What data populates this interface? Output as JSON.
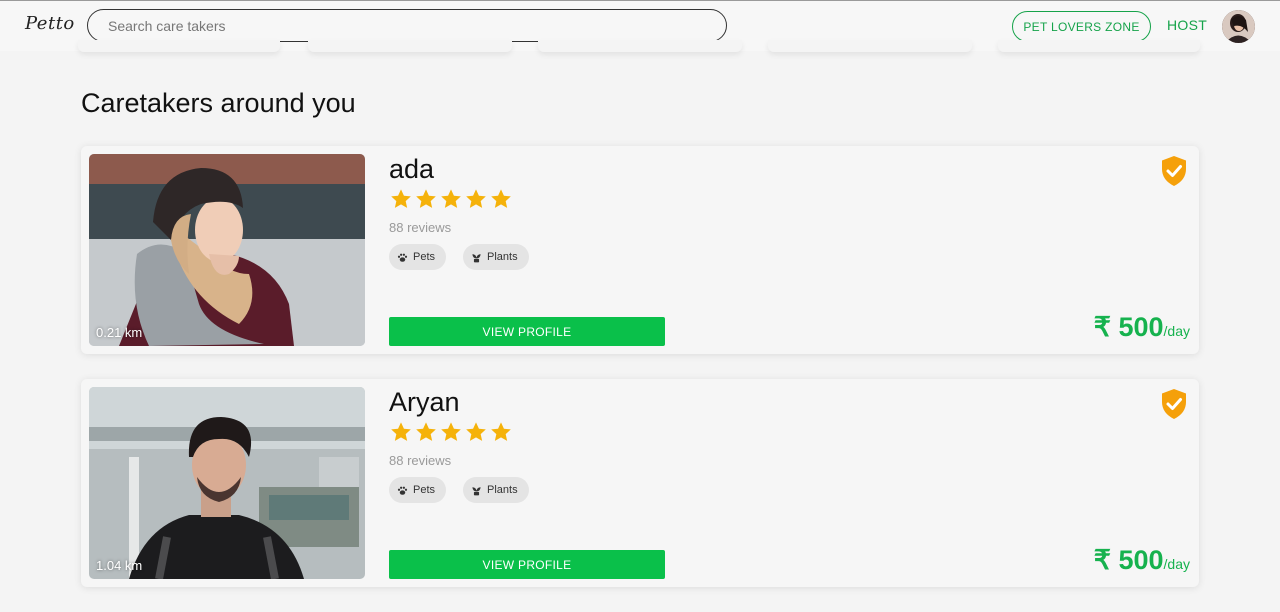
{
  "header": {
    "logo": "Petto",
    "search_placeholder": "Search care takers",
    "pet_lovers_label": "PET LOVERS ZONE",
    "host_label": "HOST"
  },
  "section_title": "Caretakers around you",
  "caretakers": [
    {
      "name": "ada",
      "rating": 5,
      "reviews": "88 reviews",
      "tags": [
        "Pets",
        "Plants"
      ],
      "distance": "0.21 km",
      "button": "VIEW PROFILE",
      "price": "₹ 500",
      "price_unit": "/day"
    },
    {
      "name": "Aryan",
      "rating": 5,
      "reviews": "88 reviews",
      "tags": [
        "Pets",
        "Plants"
      ],
      "distance": "1.04 km",
      "button": "VIEW PROFILE",
      "price": "₹ 500",
      "price_unit": "/day"
    }
  ],
  "colors": {
    "brand_green": "#16b24e",
    "button_green": "#0ac04a",
    "star": "#f5b20a",
    "badge": "#f5a00a"
  }
}
